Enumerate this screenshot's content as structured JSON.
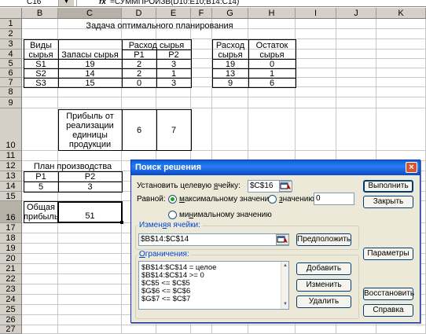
{
  "formula_bar": {
    "name_box": "C16",
    "fx": "fx",
    "formula": "=СУММПРОИЗВ(D10:E10;B14:C14)"
  },
  "columns": [
    "B",
    "C",
    "D",
    "E",
    "F",
    "G",
    "H",
    "I",
    "J",
    "K"
  ],
  "rows": [
    "1",
    "2",
    "3",
    "4",
    "5",
    "6",
    "7",
    "8",
    "9",
    "10",
    "11",
    "12",
    "13",
    "14",
    "15",
    "16",
    "17",
    "18",
    "19",
    "20",
    "21",
    "22",
    "23",
    "24",
    "25",
    "26",
    "27"
  ],
  "sheet": {
    "title": "Задача оптимального планирования",
    "res_kind_1": "Виды",
    "res_kind_2": "сырья",
    "stock": "Запасы сырья",
    "usage": "Расход сырья",
    "p1": "P1",
    "p2": "P2",
    "usage2_1": "Расход",
    "usage2_2": "сырья",
    "rest_1": "Остаток",
    "rest_2": "сырья",
    "rows": [
      {
        "name": "S1",
        "stock": "19",
        "p1": "2",
        "p2": "3",
        "used": "19",
        "rest": "0"
      },
      {
        "name": "S2",
        "stock": "14",
        "p1": "2",
        "p2": "1",
        "used": "13",
        "rest": "1"
      },
      {
        "name": "S3",
        "stock": "15",
        "p1": "0",
        "p2": "3",
        "used": "9",
        "rest": "6"
      }
    ],
    "profit_label": [
      "Прибыль от",
      "реализации",
      "единицы",
      "продукции"
    ],
    "profit_p1": "6",
    "profit_p2": "7",
    "plan_title": "План производства",
    "plan_p1": "P1",
    "plan_p2": "P2",
    "plan_v1": "5",
    "plan_v2": "3",
    "total_1": "Общая",
    "total_2": "прибыль",
    "total_value": "51"
  },
  "dialog": {
    "title": "Поиск решения",
    "target_label_pre": "Установить целевую ",
    "target_label_u": "я",
    "target_label_post": "чейку:",
    "target_value": "$C$16",
    "equal_label": "Равной:",
    "max_u": "м",
    "max_rest": "аксимальному значению",
    "val_u": "з",
    "val_rest": "начению:",
    "val_value": "0",
    "min_pre": "ми",
    "min_u": "н",
    "min_rest": "имальному значению",
    "changing_pre": "Измен",
    "changing_u": "я",
    "changing_post": "я ячейки:",
    "changing_value": "$B$14:$C$14",
    "guess": "Предположить",
    "constraints_pre": "",
    "constraints_u": "О",
    "constraints_post": "граничения:",
    "constraints": [
      "$B$14:$C$14 = целое",
      "$B$14:$C$14 >= 0",
      "$C$5 <= $C$5",
      "$G$6 <= $C$6",
      "$G$7 <= $C$7"
    ],
    "add": "Добавить",
    "change": "Изменить",
    "delete": "Удалить",
    "run": "Выполнить",
    "close": "Закрыть",
    "params": "Параметры",
    "restore": "Восстановить",
    "help": "Справка",
    "close_icon": "×"
  }
}
